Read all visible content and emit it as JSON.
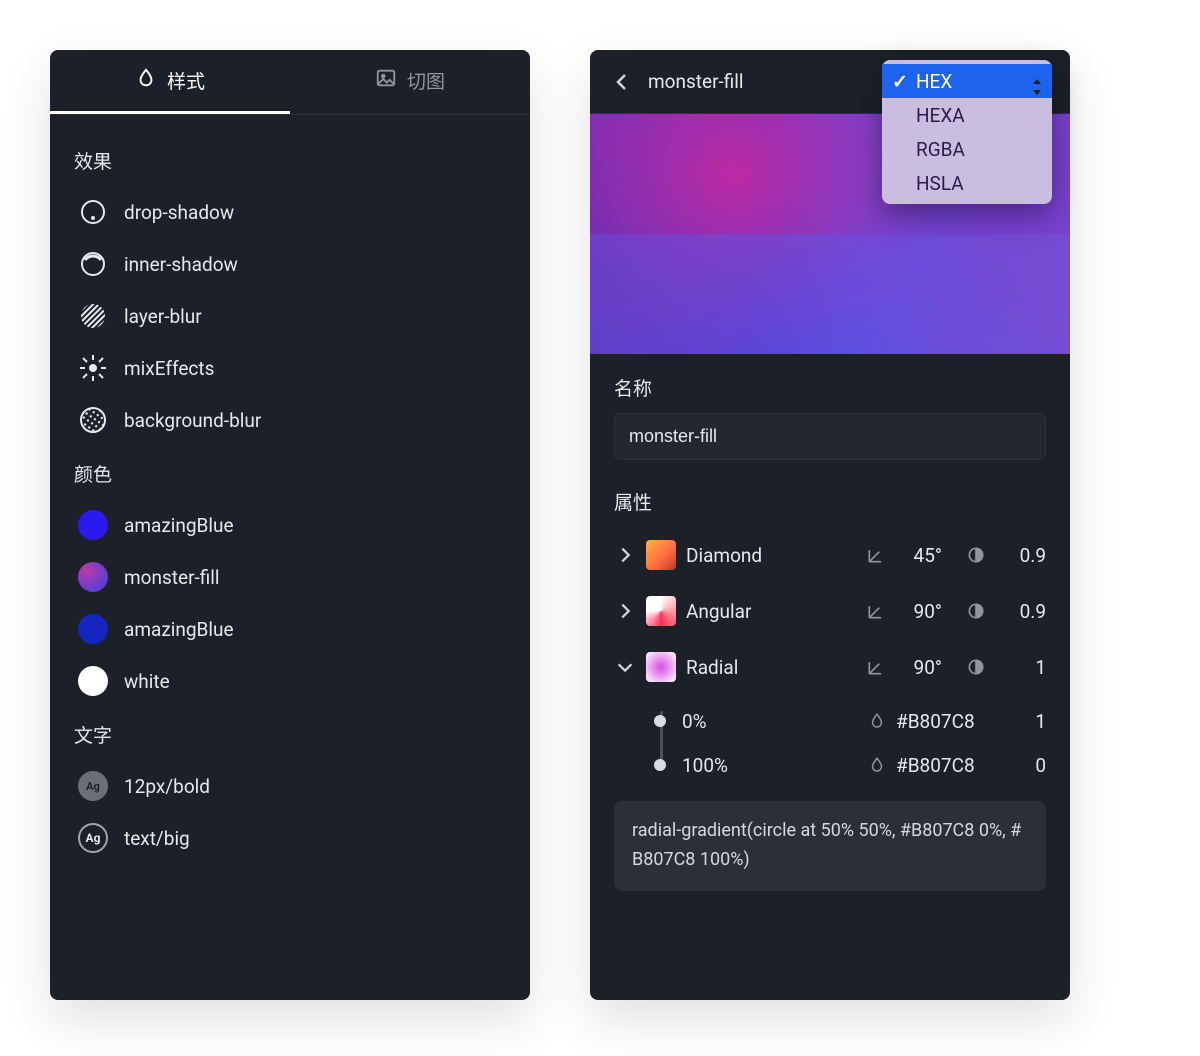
{
  "left": {
    "tabs": [
      {
        "label": "样式",
        "active": true
      },
      {
        "label": "切图",
        "active": false
      }
    ],
    "sections": {
      "effects_label": "效果",
      "colors_label": "颜色",
      "text_label": "文字"
    },
    "effects": [
      {
        "name": "drop-shadow"
      },
      {
        "name": "inner-shadow"
      },
      {
        "name": "layer-blur"
      },
      {
        "name": "mixEffects"
      },
      {
        "name": "background-blur"
      }
    ],
    "colors": [
      {
        "name": "amazingBlue",
        "swatch": "#2a1af0"
      },
      {
        "name": "monster-fill",
        "swatch": "gradient"
      },
      {
        "name": "amazingBlue",
        "swatch": "#1425c0"
      },
      {
        "name": "white",
        "swatch": "#ffffff"
      }
    ],
    "texts": [
      {
        "name": "12px/bold",
        "style": "solid"
      },
      {
        "name": "text/big",
        "style": "outline"
      }
    ]
  },
  "right": {
    "title": "monster-fill",
    "format_options": [
      "HEX",
      "HEXA",
      "RGBA",
      "HSLA"
    ],
    "format_selected": "HEX",
    "name_label": "名称",
    "name_value": "monster-fill",
    "props_label": "属性",
    "props": [
      {
        "type": "Diamond",
        "angle": "45°",
        "alpha": "0.9",
        "expanded": false,
        "thumb": "diamond"
      },
      {
        "type": "Angular",
        "angle": "90°",
        "alpha": "0.9",
        "expanded": false,
        "thumb": "angular"
      },
      {
        "type": "Radial",
        "angle": "90°",
        "alpha": "1",
        "expanded": true,
        "thumb": "radial"
      }
    ],
    "stops": [
      {
        "position": "0%",
        "color": "#B807C8",
        "alpha": "1"
      },
      {
        "position": "100%",
        "color": "#B807C8",
        "alpha": "0"
      }
    ],
    "code": "radial-gradient(circle at 50% 50%, #B807C8 0%, #B807C8 100%)"
  }
}
